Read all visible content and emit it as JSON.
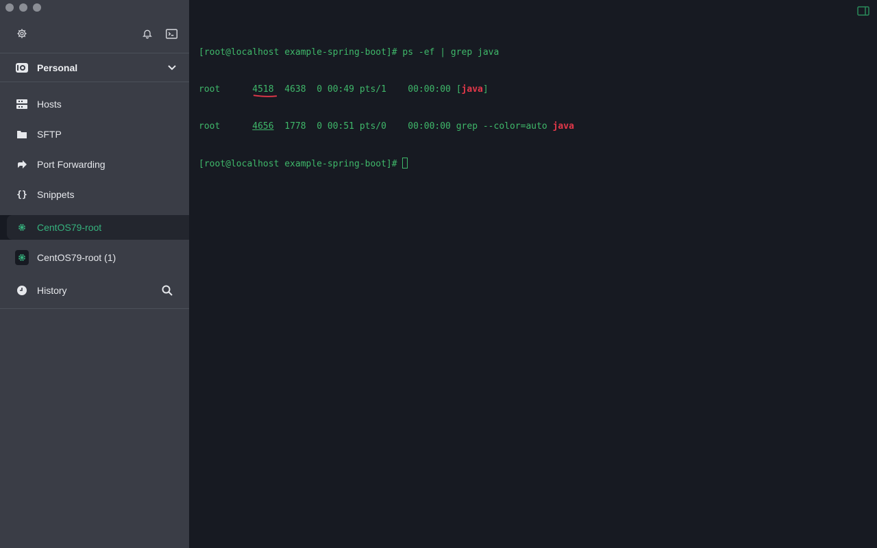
{
  "window": {
    "traffic_lights": [
      "close",
      "minimize",
      "maximize"
    ]
  },
  "toolbar": {
    "settings_icon": "gear-icon",
    "notifications_icon": "bell-icon",
    "terminal_icon": "terminal-icon"
  },
  "vault": {
    "label": "Personal",
    "icon": "vault-icon",
    "chevron": "chevron-down-icon"
  },
  "nav": {
    "items": [
      {
        "label": "Hosts",
        "icon": "server-icon"
      },
      {
        "label": "SFTP",
        "icon": "folder-icon"
      },
      {
        "label": "Port Forwarding",
        "icon": "forward-arrow-icon"
      },
      {
        "label": "Snippets",
        "icon": "braces-icon"
      }
    ]
  },
  "tabs": [
    {
      "label": "CentOS79-root",
      "active": true,
      "icon": "centos-icon"
    },
    {
      "label": "CentOS79-root (1)",
      "active": false,
      "icon": "centos-icon"
    }
  ],
  "history": {
    "label": "History",
    "icon": "clock-icon",
    "search_icon": "search-icon"
  },
  "terminal": {
    "line1": "[root@localhost example-spring-boot]# ps -ef | grep java",
    "line2": {
      "user": "root",
      "pid": "4518",
      "ppid": "4638",
      "rest": "  0 00:49 pts/1    00:00:00 [",
      "highlight": "java",
      "end": "]"
    },
    "line3": {
      "user": "root",
      "pid": "4656",
      "ppid": "1778",
      "rest": "  0 00:51 pts/0    00:00:00 grep --color=auto ",
      "highlight": "java"
    },
    "line4": "[root@localhost example-spring-boot]# "
  },
  "colors": {
    "terminal_bg": "#171a22",
    "terminal_text": "#3fb86a",
    "highlight": "#e5384a",
    "sidebar_bg": "#3a3d46",
    "active_tab_text": "#36b37e"
  }
}
